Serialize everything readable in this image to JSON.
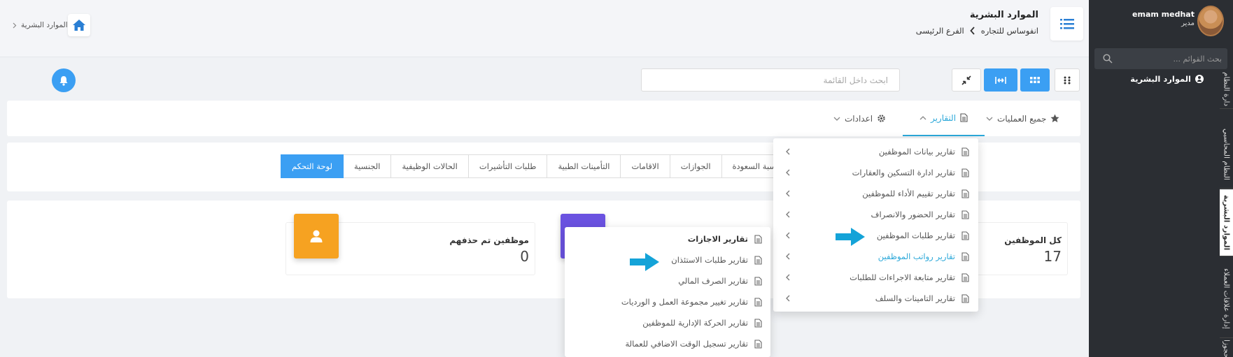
{
  "header": {
    "page_title": "الموارد البشرية",
    "company": "انفوساس للتجاره",
    "branch": "الفرع الرئيسى",
    "left_breadcrumb": "الموارد البشرية"
  },
  "user": {
    "name": "emam medhat",
    "role": "مدير"
  },
  "sidebar": {
    "search_placeholder": "بحث القوائم ...",
    "active_item": "الموارد البشرية",
    "vertical_tabs": [
      "دارة النظام",
      "النظام المحاسبي",
      "الموارد البشرية",
      "إدارة علاقات العملاء",
      "حجوزا"
    ]
  },
  "toolbar": {
    "search_placeholder": "ابحث داخل القائمة"
  },
  "menubar": {
    "all_operations": "جميع العمليات",
    "reports": "التقارير",
    "settings": "اعدادات"
  },
  "tabs": [
    "لوحة التحكم",
    "الجنسية",
    "الحالات الوظيفية",
    "طلبات التأشيرات",
    "التأمينات الطبية",
    "الاقامات",
    "الجوازات",
    "نسبة السعودة"
  ],
  "stats": [
    {
      "label": "كل الموظفين",
      "value": "17"
    },
    {
      "label": "موظفين تم حذفهم",
      "value": "0"
    }
  ],
  "reports_dropdown": [
    "تقارير بيانات الموظفين",
    "تقارير ادارة التسكين والعقارات",
    "تقارير تقييم الأداء للموظفين",
    "تقارير الحضور والانصراف",
    "تقارير طلبات الموظفين",
    "تقارير رواتب الموظفين",
    "تقارير متابعة الاجراءات للطلبات",
    "تقارير التامينات والسلف"
  ],
  "requests_submenu": [
    "تقارير الاجازات",
    "تقارير طلبات الاستئذان",
    "تقارير الصرف المالي",
    "تقارير تغيير مجموعة العمل و الورديات",
    "تقارير الحركة الإدارية للموظفين",
    "تقارير تسجيل الوقت الاضافي للعمالة"
  ],
  "colors": {
    "primary": "#3b9ff3",
    "accent_text": "#2ba8d9",
    "sidebar": "#2b2e33",
    "orange": "#f6a221",
    "purple": "#6a52e0",
    "arrow": "#14a3d8"
  }
}
